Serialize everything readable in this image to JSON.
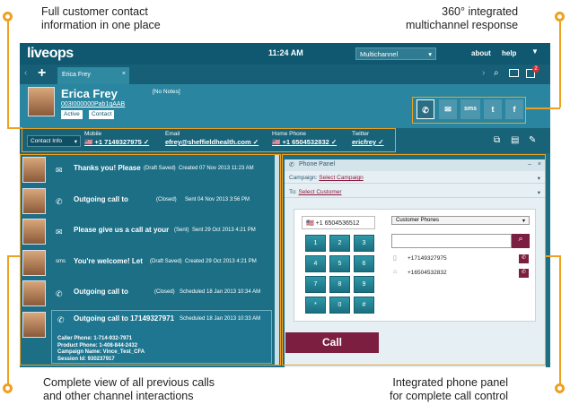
{
  "callouts": {
    "top_left": "Full customer contact\ninformation in one place",
    "top_right": "360° integrated\nmultichannel response",
    "bottom_left": "Complete view of all previous calls\nand other channel interactions",
    "bottom_right": "Integrated phone panel\nfor complete call control"
  },
  "topbar": {
    "logo": "liveops",
    "time": "11:24 AM",
    "channel_select": "Multichannel",
    "about": "about",
    "help": "help",
    "notification_count": "2"
  },
  "tab": {
    "label": "Erica Frey"
  },
  "customer": {
    "name": "Erica Frey",
    "account": "003I000000Pab1qAAB",
    "status_btn": "Active",
    "contact_btn": "Contact",
    "notes": "[No Notes]"
  },
  "channels": [
    "phone",
    "email",
    "sms",
    "twitter",
    "facebook"
  ],
  "channels_labels": {
    "sms": "sms",
    "twitter": "t",
    "facebook": "f"
  },
  "contact_bar": {
    "select": "Contact Info",
    "mobile_label": "Mobile",
    "mobile": "+1 7149327975",
    "email_label": "Email",
    "email": "efrey@sheffieldhealth.com",
    "home_label": "Home Phone",
    "home": "+1 6504532832",
    "twitter_label": "Twitter",
    "twitter": "ericfrey"
  },
  "history": [
    {
      "icon": "email",
      "title": "Thanks you! Please",
      "status": "(Draft Saved)",
      "date": "Created 07 Nov 2013 11:23 AM"
    },
    {
      "icon": "phone",
      "title": "Outgoing call to",
      "status": "(Closed)",
      "date": "Sent 04 Nov 2013 3:56 PM"
    },
    {
      "icon": "sms",
      "title": "Please give us a call at your",
      "status": "(Sent)",
      "date": "Sent 29 Oct 2013 4:21 PM"
    },
    {
      "icon": "sms",
      "title": "You're welcome! Let",
      "status": "(Draft Saved)",
      "date": "Created 29 Oct 2013 4:21 PM"
    },
    {
      "icon": "phone",
      "title": "Outgoing call to",
      "status": "(Closed)",
      "date": "Scheduled 18 Jan 2013 10:34 AM"
    },
    {
      "icon": "phone",
      "title": "Outgoing call to 17149327971",
      "status": "",
      "date": "Scheduled 18 Jan 2013 10:33 AM"
    }
  ],
  "history_detail": {
    "caller": "Caller Phone: 1-714-932-7971",
    "product": "Product Phone: 1-408-844-2432",
    "campaign": "Campaign Name: Vince_Test_CFA",
    "session": "Session Id: 930237917"
  },
  "phone_panel": {
    "title": "Phone Panel",
    "campaign_label": "Campaign:",
    "campaign_link": "Select Campaign",
    "to_label": "To:",
    "to_link": "Select Customer",
    "dial_number": "+1 6504536512",
    "keys": [
      "1",
      "2",
      "3",
      "4",
      "5",
      "6",
      "7",
      "8",
      "9",
      "*",
      "0",
      "#"
    ],
    "customer_phones": "Customer Phones",
    "phones": [
      "+17149327975",
      "+16504532832"
    ],
    "call_button": "Call"
  }
}
